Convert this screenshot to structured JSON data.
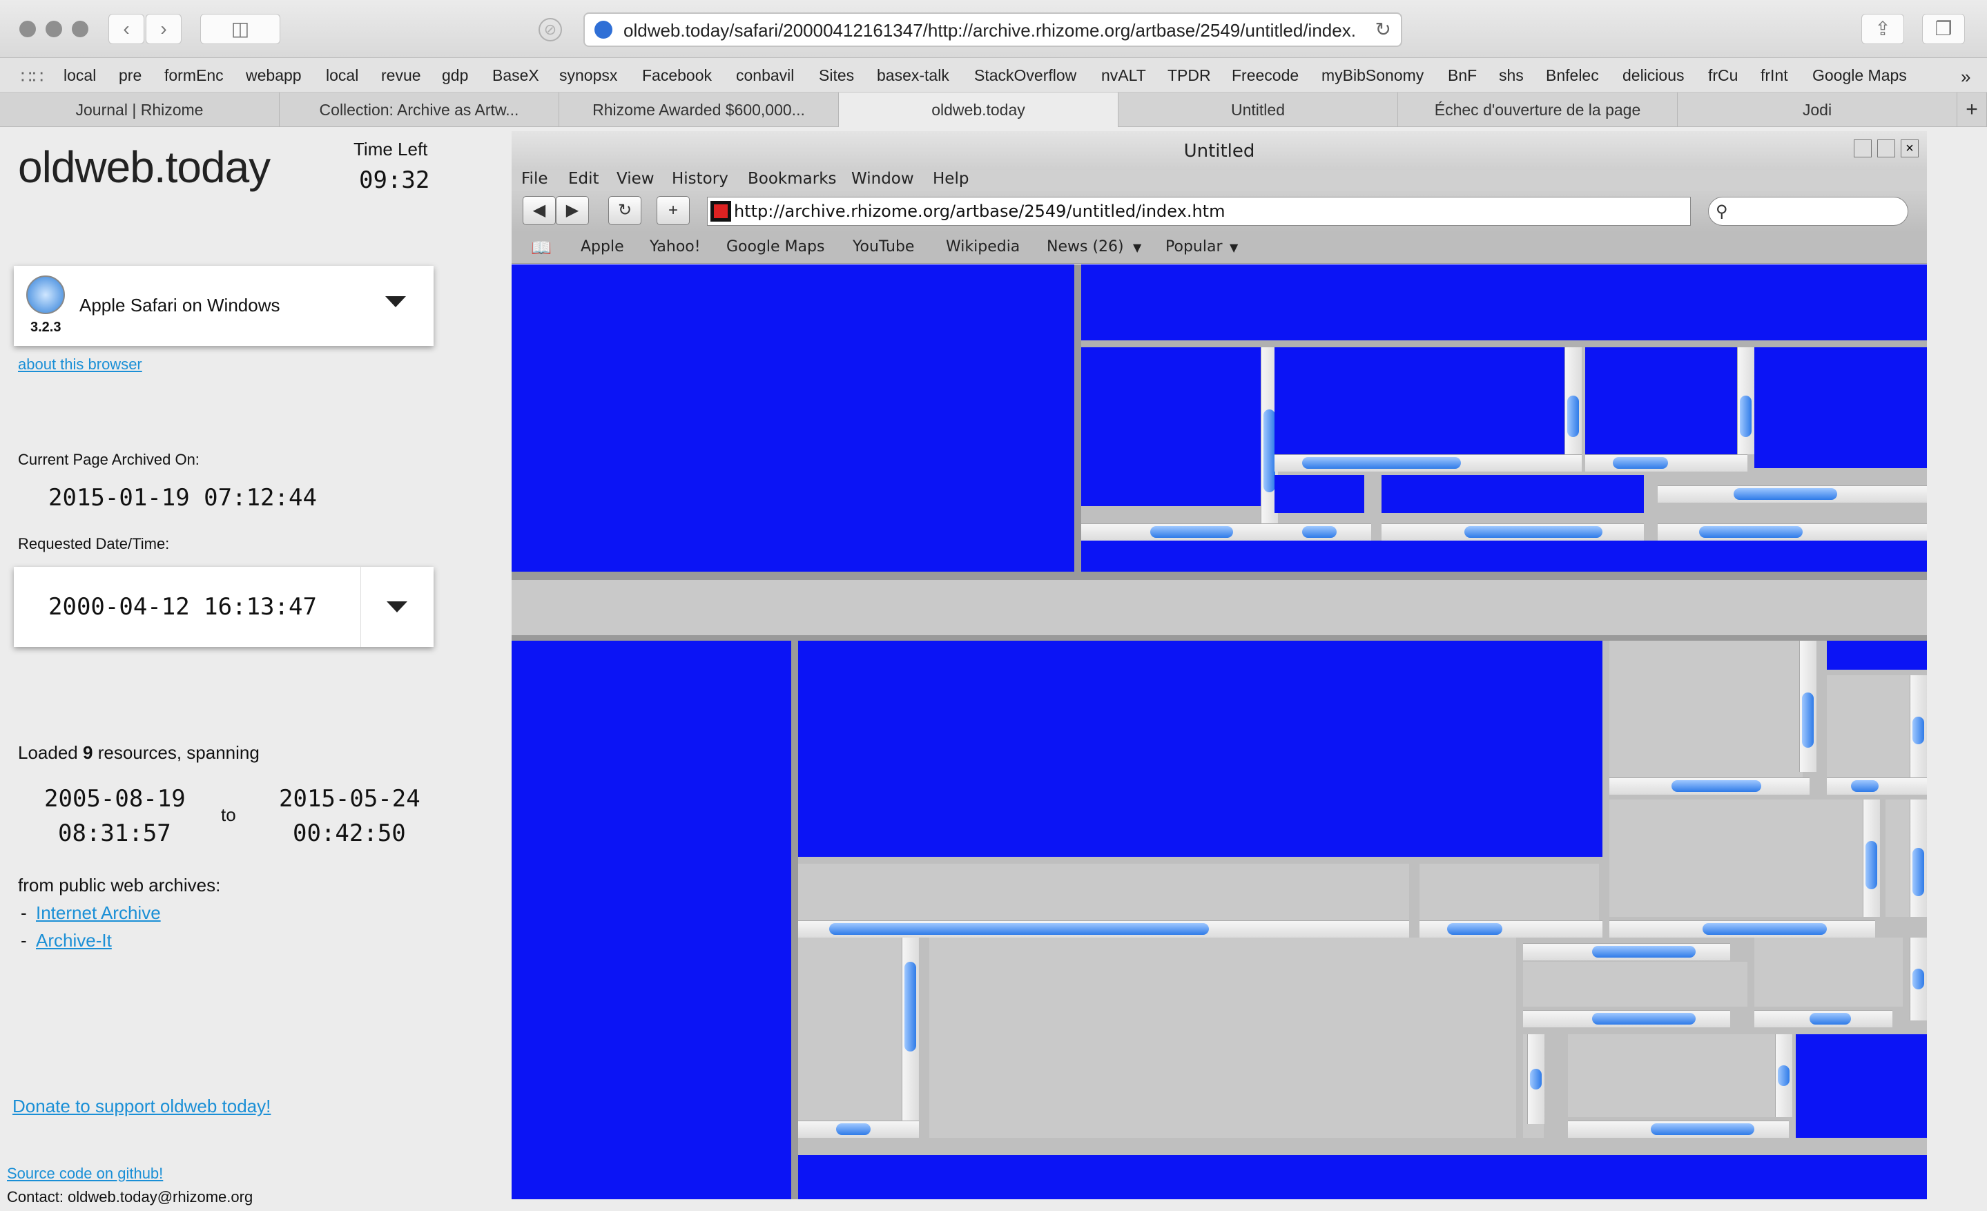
{
  "browser": {
    "address_url": "oldweb.today/safari/20000412161347/http://archive.rhizome.org/artbase/2549/untitled/index.",
    "bookmarks": [
      "local",
      "pre",
      "formEnc",
      "webapp",
      "local",
      "revue",
      "gdp",
      "BaseX",
      "synopsx",
      "Facebook",
      "conbavil",
      "Sites",
      "basex-talk",
      "StackOverflow",
      "nvALT",
      "TPDR",
      "Freecode",
      "myBibSonomy",
      "BnF",
      "shs",
      "Bnfelec",
      "delicious",
      "frCu",
      "frInt",
      "Google Maps"
    ],
    "tabs": [
      "Journal | Rhizome",
      "Collection: Archive as Artw...",
      "Rhizome Awarded $600,000...",
      "oldweb.today",
      "Untitled",
      "Échec d'ouverture de la page",
      "Jodi"
    ],
    "active_tab_index": 3
  },
  "panel": {
    "logo": "oldweb.today",
    "time_left_label": "Time Left",
    "time_left_value": "09:32",
    "browser_name": "Apple Safari on Windows",
    "browser_version": "3.2.3",
    "about_link": "about this browser",
    "archived_label": "Current Page Archived On:",
    "archived_value": "2015-01-19 07:12:44",
    "requested_label": "Requested Date/Time:",
    "requested_value": "2000-04-12 16:13:47",
    "loaded_prefix": "Loaded",
    "loaded_count": "9",
    "loaded_suffix": "resources, spanning",
    "span_start_date": "2005-08-19",
    "span_start_time": "08:31:57",
    "span_to": "to",
    "span_end_date": "2015-05-24",
    "span_end_time": "00:42:50",
    "archives_label": "from public web archives:",
    "archives": [
      "Internet Archive",
      "Archive-It"
    ],
    "donate": "Donate to support oldweb today!",
    "source": "Source code on github!",
    "contact": "Contact: oldweb.today@rhizome.org"
  },
  "emulated": {
    "window_title": "Untitled",
    "menu": [
      "File",
      "Edit",
      "View",
      "History",
      "Bookmarks",
      "Window",
      "Help"
    ],
    "url": "http://archive.rhizome.org/artbase/2549/untitled/index.htm",
    "bookmarks": [
      "Apple",
      "Yahoo!",
      "Google Maps",
      "YouTube",
      "Wikipedia",
      "News (26)",
      "Popular"
    ]
  },
  "colors": {
    "page_blue": "#0b14f5",
    "link": "#1a8fd6"
  }
}
